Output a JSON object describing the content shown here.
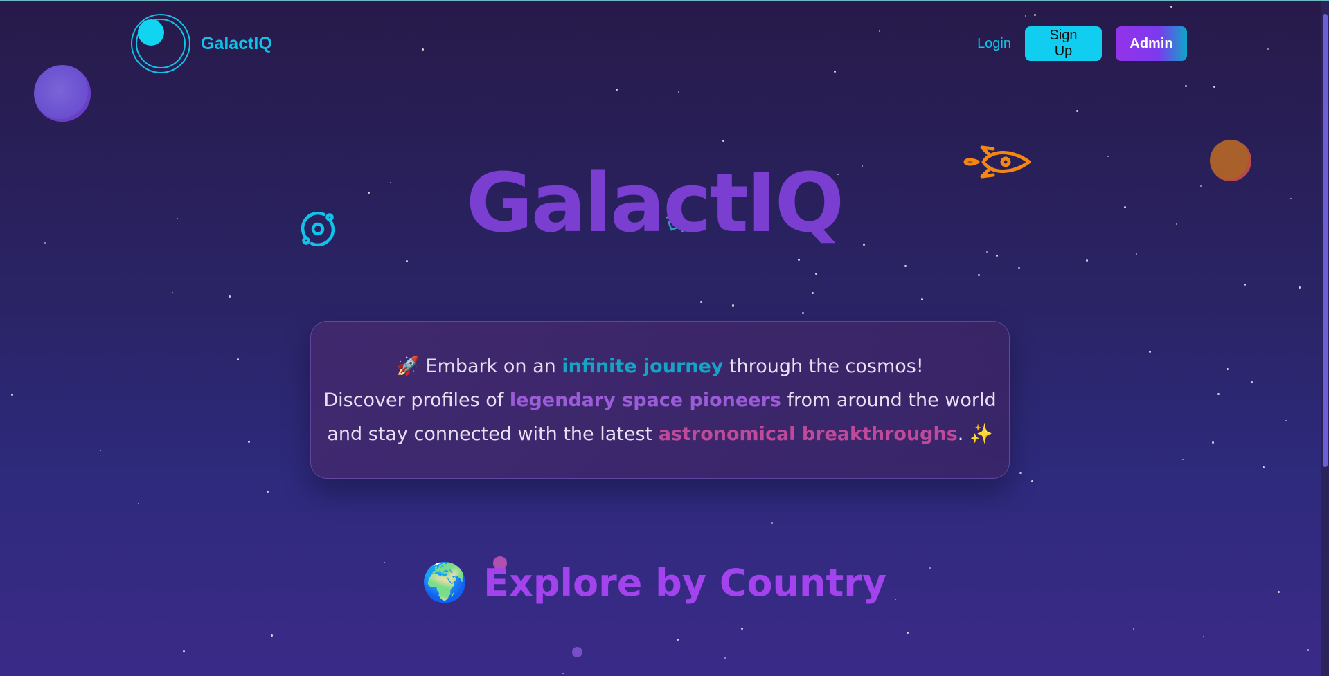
{
  "nav": {
    "brand": "GalactIQ",
    "login_label": "Login",
    "signup_label": "Sign Up",
    "admin_label": "Admin"
  },
  "hero": {
    "title": "GalactIQ",
    "intro": {
      "emoji_start": "🚀",
      "line1_a": "Embark on an ",
      "line1_hl": "infinite journey",
      "line1_b": " through the cosmos!",
      "line2_a": "Discover profiles of ",
      "line2_hl": "legendary space pioneers",
      "line2_b": " from around the world",
      "line3_a": "and stay connected with the latest ",
      "line3_hl": "astronomical breakthroughs",
      "line3_b": ".",
      "emoji_end": "✨"
    }
  },
  "explore": {
    "emoji": "🌍",
    "title": "Explore by Country"
  },
  "colors": {
    "accent_cyan": "#11c3e8",
    "accent_purple": "#a243ee",
    "title_purple": "#7a3fd0"
  },
  "icons": [
    "logo-orbit-icon",
    "rocket-icon",
    "orbit-icon",
    "satellite-icon",
    "globe-icon"
  ]
}
